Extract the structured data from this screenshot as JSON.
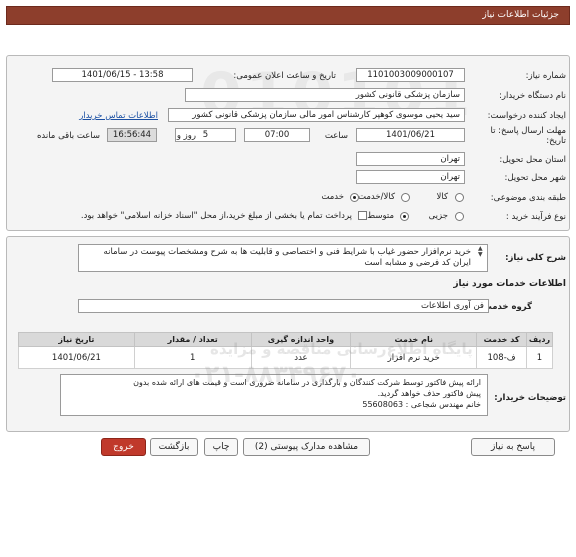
{
  "header": {
    "title": "جزئیات اطلاعات نیاز"
  },
  "need_number": {
    "label": "شماره نیاز:",
    "value": "1101003009000107"
  },
  "announce_datetime": {
    "label": "تاریخ و ساعت اعلان عمومی:",
    "value": "1401/06/15 - 13:58"
  },
  "buyer_org": {
    "label": "نام دستگاه خریدار:",
    "value": "سازمان پزشکی قانونی کشور"
  },
  "requester": {
    "label": "ایجاد کننده درخواست:",
    "value": "سید یحیی موسوی کوهپر کارشناس امور مالی سازمان پزشکی قانونی کشور",
    "contact_link": "اطلاعات تماس خریدار"
  },
  "deadline": {
    "label": "مهلت ارسال پاسخ: تا تاریخ:",
    "date": "1401/06/21",
    "time_label": "ساعت",
    "time": "07:00",
    "days": "5",
    "days_label": "روز و",
    "remaining": "16:56:44",
    "remaining_label": "ساعت باقی مانده"
  },
  "province": {
    "label": "استان محل تحویل:",
    "value": "تهران"
  },
  "city": {
    "label": "شهر محل تحویل:",
    "value": "تهران"
  },
  "category": {
    "label": "طبقه بندی موضوعی:",
    "options": [
      "کالا",
      "کالا/خدمت",
      "خدمت"
    ],
    "selected": "خدمت"
  },
  "purchase_process": {
    "label": "نوع فرآیند خرید :",
    "options": [
      "جزیی",
      "متوسط"
    ],
    "selected": "متوسط",
    "payment_note": "پرداخت تمام یا بخشی از مبلغ خرید،از محل \"اسناد خزانه اسلامی\" خواهد بود."
  },
  "need_summary": {
    "label": "شرح کلی نیاز:",
    "text": "خرید نرم‌افزار حضور غیاب  با شرایط فنی و اختصاصی و قابلیت ها به شرح ومشخصات پیوست در سامانه ایران کد فرضی و مشابه است"
  },
  "services_section": {
    "title": "اطلاعات خدمات مورد نیاز"
  },
  "service_group": {
    "label": "گروه خدمت:",
    "value": "فن آوری اطلاعات"
  },
  "table": {
    "headers": [
      "ردیف",
      "کد خدمت",
      "نام خدمت",
      "واحد اندازه گیری",
      "تعداد / مقدار",
      "تاریخ نیاز"
    ],
    "rows": [
      [
        "1",
        "ف-108",
        "خرید نرم افزار",
        "عدد",
        "1",
        "1401/06/21"
      ]
    ]
  },
  "buyer_notes": {
    "label": "توضیحات خریدار:",
    "line1": "ارائه پیش فاکتور  توسط شرکت کنندگان و بارگذاری در سامانه ضروری است و قیمت های ارائه شده بدون",
    "line2": "پیش فاکتور حذف خواهد گردید.",
    "line3": "خانم مهندس شجاعی :         55608063"
  },
  "buttons": {
    "reply": "پاسخ به نیاز",
    "attachments": "مشاهده مدارک پیوستی (2)",
    "print": "چاپ",
    "back": "بازگشت",
    "exit": "خروج"
  },
  "watermark": {
    "line1": "پارس‌نماد داده",
    "line2": "ParsNamadData",
    "line3": "پایگاه اطلاع‌رسانی مناقصه و مزایده",
    "line4": "۰۲۱-۸۸۳۴۹۶۷۰"
  },
  "colors": {
    "header": "#8d3e2c",
    "exit_button": "#c0392b",
    "link": "#1a4fa3"
  }
}
